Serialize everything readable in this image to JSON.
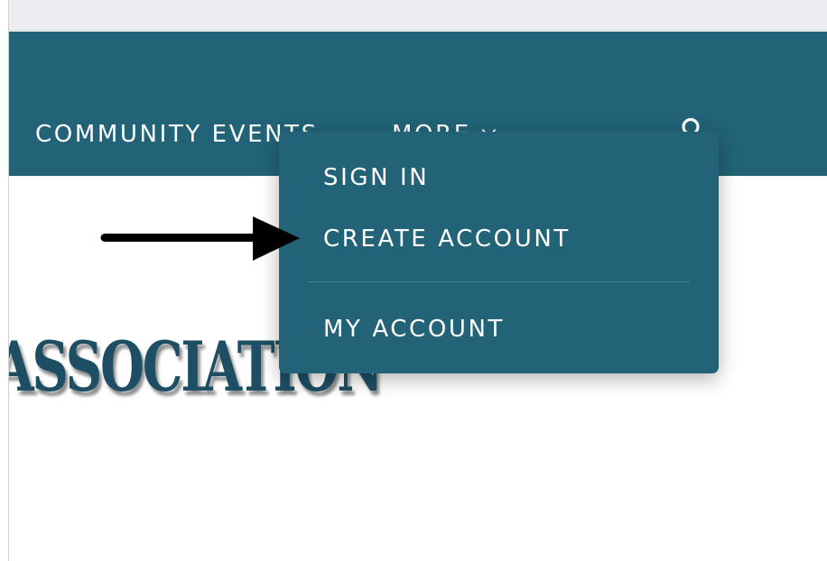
{
  "nav": {
    "community_events_label": "COMMUNITY EVENTS",
    "more_label": "MORE",
    "account_icon": "user-icon"
  },
  "dropdown": {
    "sign_in_label": "SIGN IN",
    "create_account_label": "CREATE ACCOUNT",
    "my_account_label": "MY ACCOUNT"
  },
  "logo": {
    "partial_text": "ASSOCIATION"
  },
  "annotation": {
    "icon": "arrow-right-icon"
  },
  "colors": {
    "nav_background": "#226377",
    "nav_text": "#ffffff",
    "logo_text": "#1d4e64",
    "annotation_arrow": "#000000"
  }
}
